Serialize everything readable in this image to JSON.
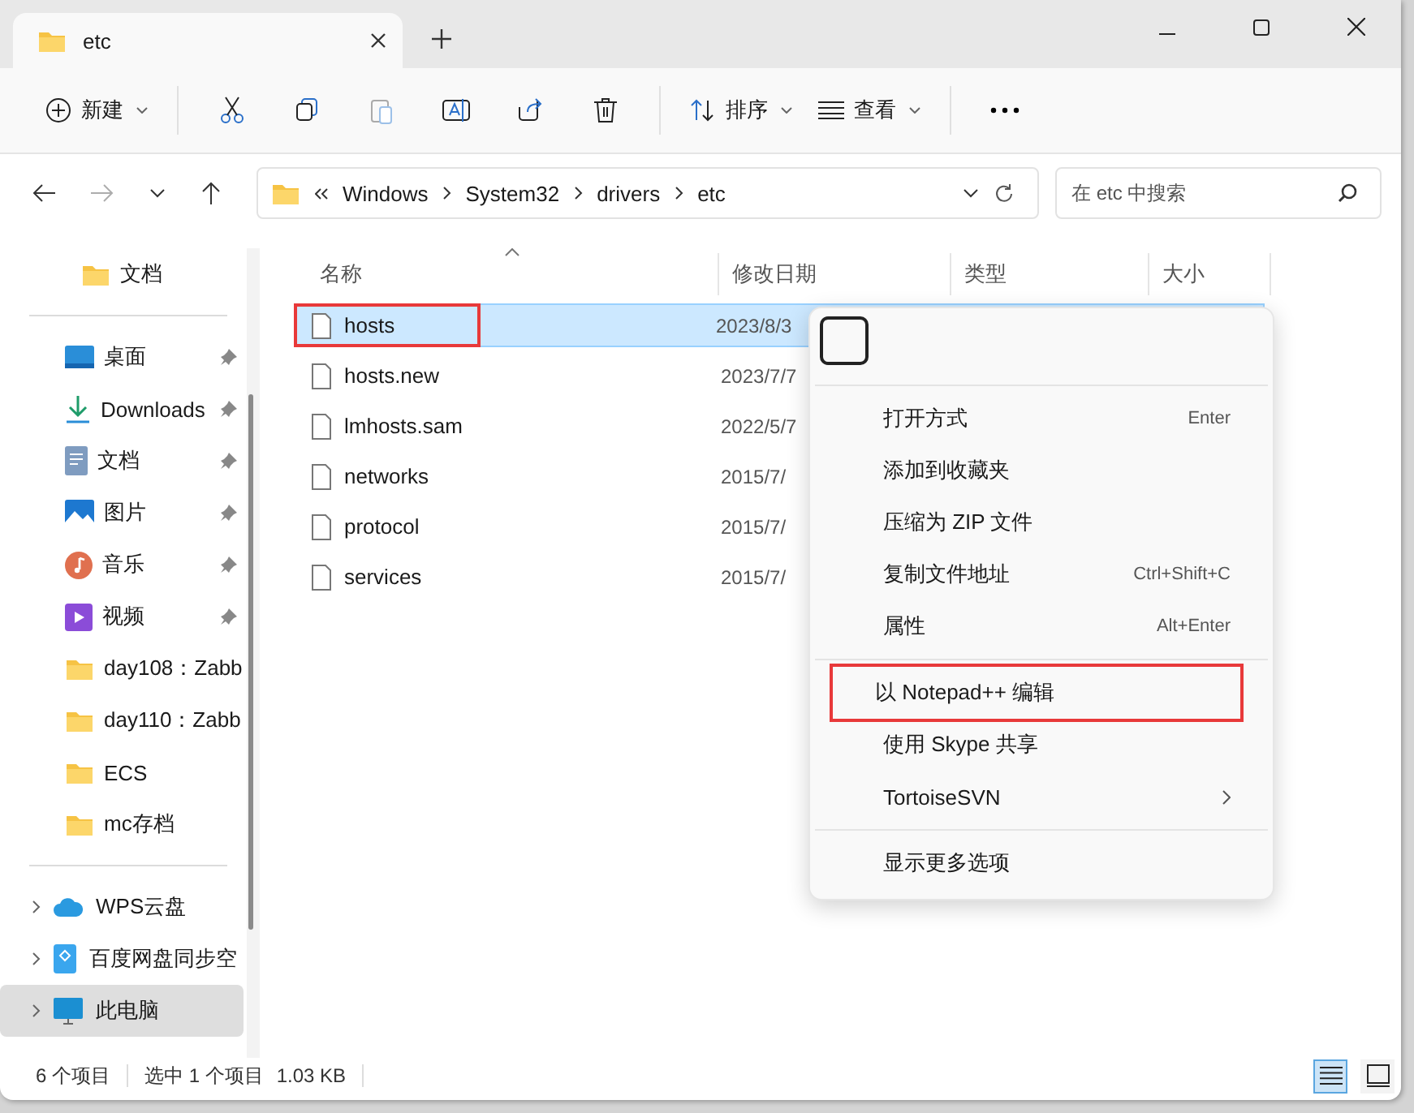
{
  "tabs": [
    {
      "label": "etc",
      "selected": true
    }
  ],
  "toolbar": {
    "new_label": "新建",
    "sort_label": "排序",
    "view_label": "查看"
  },
  "address": {
    "crumbs": [
      "Windows",
      "System32",
      "drivers",
      "etc"
    ]
  },
  "search": {
    "placeholder": "在 etc 中搜索"
  },
  "sidebar": {
    "top_item": {
      "label": "文档"
    },
    "pinned": [
      {
        "label": "桌面",
        "kind": "desktop",
        "pinned": true
      },
      {
        "label": "Downloads",
        "kind": "download",
        "pinned": true
      },
      {
        "label": "文档",
        "kind": "document",
        "pinned": true
      },
      {
        "label": "图片",
        "kind": "picture",
        "pinned": true
      },
      {
        "label": "音乐",
        "kind": "music",
        "pinned": true
      },
      {
        "label": "视频",
        "kind": "video",
        "pinned": true
      },
      {
        "label": "day108：Zabb",
        "kind": "folder",
        "pinned": false
      },
      {
        "label": "day110：Zabb",
        "kind": "folder",
        "pinned": false
      },
      {
        "label": "ECS",
        "kind": "folder",
        "pinned": false
      },
      {
        "label": "mc存档",
        "kind": "folder",
        "pinned": false
      }
    ],
    "drives": [
      {
        "label": "WPS云盘",
        "kind": "cloud",
        "selected": false
      },
      {
        "label": "百度网盘同步空",
        "kind": "drive",
        "selected": false
      },
      {
        "label": "此电脑",
        "kind": "computer",
        "selected": true
      }
    ]
  },
  "table": {
    "columns": [
      "名称",
      "修改日期",
      "类型",
      "大小"
    ],
    "rows": [
      {
        "name": "hosts",
        "date": "2023/8/3",
        "selected": true,
        "annotated": true
      },
      {
        "name": "hosts.new",
        "date": "2023/7/7",
        "selected": false,
        "annotated": false
      },
      {
        "name": "lmhosts.sam",
        "date": "2022/5/7",
        "selected": false,
        "annotated": false
      },
      {
        "name": "networks",
        "date": "2015/7/",
        "selected": false,
        "annotated": false
      },
      {
        "name": "protocol",
        "date": "2015/7/",
        "selected": false,
        "annotated": false
      },
      {
        "name": "services",
        "date": "2015/7/",
        "selected": false,
        "annotated": false
      }
    ]
  },
  "context_menu": {
    "groups": [
      [
        {
          "label": "打开方式",
          "shortcut": "Enter",
          "submenu": false,
          "annotated": false
        },
        {
          "label": "添加到收藏夹",
          "submenu": false,
          "annotated": false
        },
        {
          "label": "压缩为 ZIP 文件",
          "submenu": false,
          "annotated": false
        },
        {
          "label": "复制文件地址",
          "shortcut": "Ctrl+Shift+C",
          "submenu": false,
          "annotated": false
        },
        {
          "label": "属性",
          "shortcut": "Alt+Enter",
          "submenu": false,
          "annotated": false
        }
      ],
      [
        {
          "label": "以 Notepad++ 编辑",
          "submenu": false,
          "annotated": true
        },
        {
          "label": "使用 Skype 共享",
          "submenu": false,
          "annotated": false
        },
        {
          "label": "TortoiseSVN",
          "submenu": true,
          "annotated": false
        }
      ],
      [
        {
          "label": "显示更多选项",
          "submenu": false,
          "annotated": false
        }
      ]
    ]
  },
  "status_bar": {
    "count": "6 个项目",
    "selection": "选中 1 个项目",
    "size": "1.03 KB"
  },
  "view_buttons": [
    {
      "kind": "details",
      "selected": true
    },
    {
      "kind": "tiles",
      "selected": false
    }
  ]
}
